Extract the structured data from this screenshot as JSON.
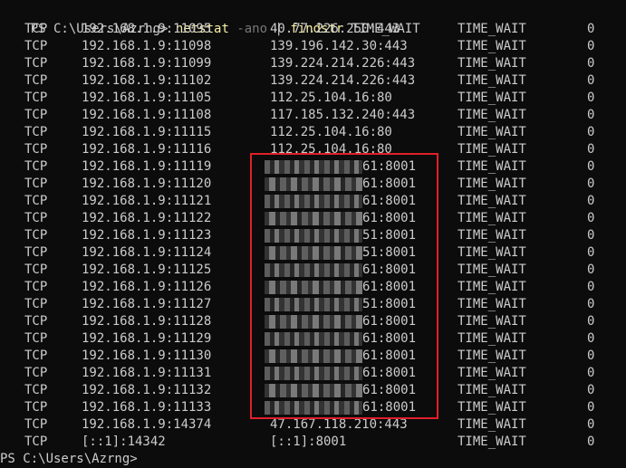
{
  "window": {
    "background": "#0c0c0c",
    "foreground": "#cccccc",
    "command_color": "#f9f1a5",
    "flag_color": "#767676",
    "highlight_box_color": "#e0202a"
  },
  "command": {
    "prompt": "PS C:\\Users\\Azrng> ",
    "program": "netstat",
    "flag": " -ano",
    "pipe": " | ",
    "filter": "findstr",
    "arg": " TIME_WAIT"
  },
  "connections": [
    {
      "proto": "TCP",
      "local": "192.168.1.9:11095",
      "foreign": "40.77.226.250:443",
      "state": "TIME_WAIT",
      "pid": "0"
    },
    {
      "proto": "TCP",
      "local": "192.168.1.9:11098",
      "foreign": "139.196.142.30:443",
      "state": "TIME_WAIT",
      "pid": "0"
    },
    {
      "proto": "TCP",
      "local": "192.168.1.9:11099",
      "foreign": "139.224.214.226:443",
      "state": "TIME_WAIT",
      "pid": "0"
    },
    {
      "proto": "TCP",
      "local": "192.168.1.9:11102",
      "foreign": "139.224.214.226:443",
      "state": "TIME_WAIT",
      "pid": "0"
    },
    {
      "proto": "TCP",
      "local": "192.168.1.9:11105",
      "foreign": "112.25.104.16:80",
      "state": "TIME_WAIT",
      "pid": "0"
    },
    {
      "proto": "TCP",
      "local": "192.168.1.9:11108",
      "foreign": "117.185.132.240:443",
      "state": "TIME_WAIT",
      "pid": "0"
    },
    {
      "proto": "TCP",
      "local": "192.168.1.9:11115",
      "foreign": "112.25.104.16:80",
      "state": "TIME_WAIT",
      "pid": "0"
    },
    {
      "proto": "TCP",
      "local": "192.168.1.9:11116",
      "foreign": "112.25.104.16:80",
      "state": "TIME_WAIT",
      "pid": "0"
    },
    {
      "proto": "TCP",
      "local": "192.168.1.9:11119",
      "foreign": "61:8001",
      "state": "TIME_WAIT",
      "pid": "0",
      "redacted": true
    },
    {
      "proto": "TCP",
      "local": "192.168.1.9:11120",
      "foreign": "61:8001",
      "state": "TIME_WAIT",
      "pid": "0",
      "redacted": true
    },
    {
      "proto": "TCP",
      "local": "192.168.1.9:11121",
      "foreign": "61:8001",
      "state": "TIME_WAIT",
      "pid": "0",
      "redacted": true
    },
    {
      "proto": "TCP",
      "local": "192.168.1.9:11122",
      "foreign": "61:8001",
      "state": "TIME_WAIT",
      "pid": "0",
      "redacted": true
    },
    {
      "proto": "TCP",
      "local": "192.168.1.9:11123",
      "foreign": "51:8001",
      "state": "TIME_WAIT",
      "pid": "0",
      "redacted": true
    },
    {
      "proto": "TCP",
      "local": "192.168.1.9:11124",
      "foreign": "51:8001",
      "state": "TIME_WAIT",
      "pid": "0",
      "redacted": true
    },
    {
      "proto": "TCP",
      "local": "192.168.1.9:11125",
      "foreign": "61:8001",
      "state": "TIME_WAIT",
      "pid": "0",
      "redacted": true
    },
    {
      "proto": "TCP",
      "local": "192.168.1.9:11126",
      "foreign": "61:8001",
      "state": "TIME_WAIT",
      "pid": "0",
      "redacted": true
    },
    {
      "proto": "TCP",
      "local": "192.168.1.9:11127",
      "foreign": "51:8001",
      "state": "TIME_WAIT",
      "pid": "0",
      "redacted": true
    },
    {
      "proto": "TCP",
      "local": "192.168.1.9:11128",
      "foreign": "61:8001",
      "state": "TIME_WAIT",
      "pid": "0",
      "redacted": true
    },
    {
      "proto": "TCP",
      "local": "192.168.1.9:11129",
      "foreign": "61:8001",
      "state": "TIME_WAIT",
      "pid": "0",
      "redacted": true
    },
    {
      "proto": "TCP",
      "local": "192.168.1.9:11130",
      "foreign": "61:8001",
      "state": "TIME_WAIT",
      "pid": "0",
      "redacted": true
    },
    {
      "proto": "TCP",
      "local": "192.168.1.9:11131",
      "foreign": "61:8001",
      "state": "TIME_WAIT",
      "pid": "0",
      "redacted": true
    },
    {
      "proto": "TCP",
      "local": "192.168.1.9:11132",
      "foreign": "61:8001",
      "state": "TIME_WAIT",
      "pid": "0",
      "redacted": true
    },
    {
      "proto": "TCP",
      "local": "192.168.1.9:11133",
      "foreign": "61:8001",
      "state": "TIME_WAIT",
      "pid": "0",
      "redacted": true
    },
    {
      "proto": "TCP",
      "local": "192.168.1.9:14374",
      "foreign": "47.167.118.210:443",
      "state": "TIME_WAIT",
      "pid": "0"
    },
    {
      "proto": "TCP",
      "local": "[::1]:14342",
      "foreign": "[::1]:8001",
      "state": "TIME_WAIT",
      "pid": "0"
    }
  ],
  "next_prompt": "PS C:\\Users\\Azrng>"
}
